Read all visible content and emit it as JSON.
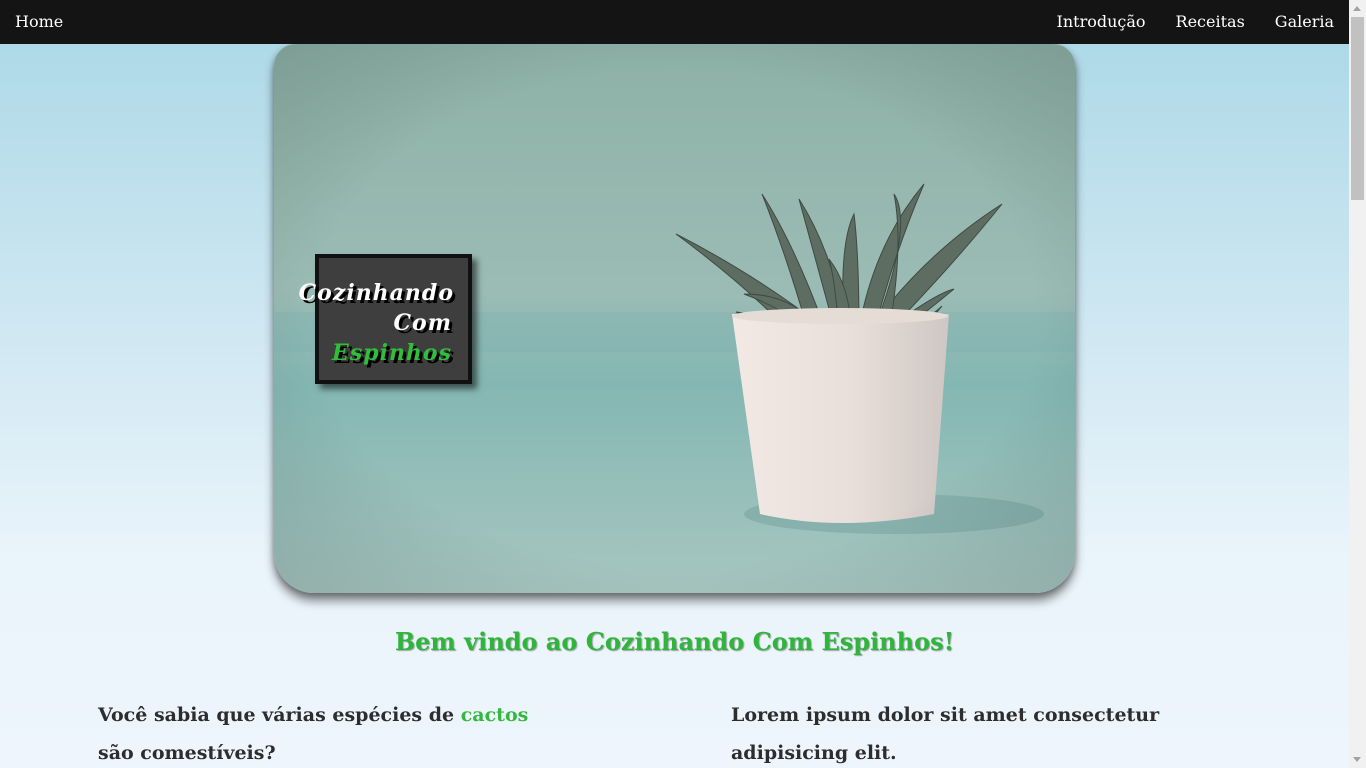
{
  "nav": {
    "home": "Home",
    "links": [
      "Introdução",
      "Receitas",
      "Galeria"
    ]
  },
  "hero": {
    "image": "potted-succulent-photo",
    "logo": {
      "line1": "Cozinhando",
      "line2": "Com",
      "line3": "Espinhos"
    }
  },
  "welcome": "Bem vindo ao Cozinhando Com Espinhos!",
  "columns": {
    "left": {
      "before": "Você sabia que várias espécies de ",
      "highlight": "cactos",
      "after": " são comestíveis?"
    },
    "right": {
      "text": "Lorem ipsum dolor sit amet consectetur adipisicing elit."
    }
  },
  "colors": {
    "nav_bg": "#141414",
    "accent_green": "#30b53b",
    "text_dark": "#2d2d2d"
  }
}
